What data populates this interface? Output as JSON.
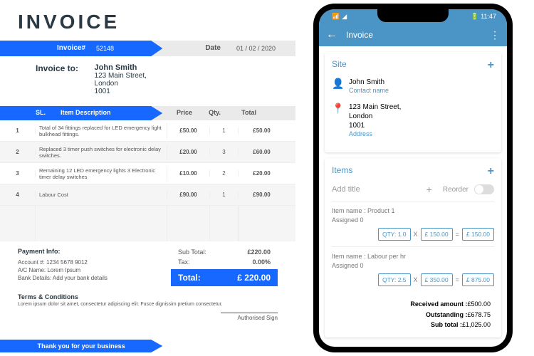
{
  "invoice": {
    "title": "INVOICE",
    "number_label": "Invoice#",
    "number": "52148",
    "date_label": "Date",
    "date": "01 / 02 / 2020",
    "to_label": "Invoice to:",
    "customer": {
      "name": "John Smith",
      "line1": "123 Main Street,",
      "line2": "London",
      "line3": "1001"
    },
    "cols": {
      "sl": "SL.",
      "desc": "Item Description",
      "price": "Price",
      "qty": "Qty.",
      "total": "Total"
    },
    "rows": [
      {
        "n": "1",
        "d": "Total of 34 fittings replaced for LED emergency light bulkhead fittings.",
        "p": "£50.00",
        "q": "1",
        "t": "£50.00"
      },
      {
        "n": "2",
        "d": "Replaced 3 timer push switches for electronic delay switches.",
        "p": "£20.00",
        "q": "3",
        "t": "£60.00"
      },
      {
        "n": "3",
        "d": "Remaining 12 LED emergency lights 3 Electronic timer delay switches",
        "p": "£10.00",
        "q": "2",
        "t": "£20.00"
      },
      {
        "n": "4",
        "d": "Labour Cost",
        "p": "£90.00",
        "q": "1",
        "t": "£90.00"
      }
    ],
    "subtotal_label": "Sub Total:",
    "subtotal": "£220.00",
    "tax_label": "Tax:",
    "tax": "0.00%",
    "total_label": "Total:",
    "total": "£ 220.00",
    "payment": {
      "h": "Payment Info:",
      "l1": "Account #:   1234 5678 9012",
      "l2": "A/C Name:    Lorem Ipsum",
      "l3": "Bank Details:   Add your bank details"
    },
    "terms": {
      "h": "Terms & Conditions",
      "body": "Lorem ipsum dolor sit amet, consectetur adipiscing elit. Fusce dignissim pretium consectetur."
    },
    "sign": "Authorised Sign",
    "thanks": "Thank you for your business"
  },
  "phone": {
    "status": {
      "time": "11:47"
    },
    "appbar": {
      "title": "Invoice"
    },
    "site": {
      "h": "Site",
      "name": "John Smith",
      "contact_link": "Contact name",
      "address": "123 Main Street,\nLondon\n1001",
      "address_link": "Address"
    },
    "items": {
      "h": "Items",
      "add_title": "Add title",
      "reorder": "Reorder",
      "list": [
        {
          "name": "Item name : Product 1",
          "assigned": "Assigned 0",
          "qty": "QTY: 1.0",
          "price": "£ 150.00",
          "total": "£ 150.00"
        },
        {
          "name": "Item name : Labour per hr",
          "assigned": "Assigned 0",
          "qty": "QTY: 2.5",
          "price": "£ 350.00",
          "total": "£ 875.00"
        }
      ]
    },
    "summary": {
      "received_l": "Received amount :",
      "received": "£500.00",
      "out_l": "Outstanding :",
      "out": "£678.75",
      "sub_l": "Sub total :",
      "sub": "£1,025.00"
    }
  }
}
